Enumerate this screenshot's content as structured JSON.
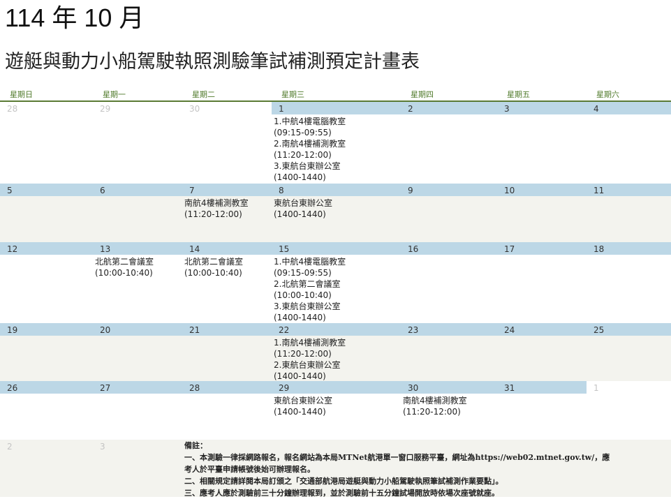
{
  "header": {
    "month_title": "114 年 10 月",
    "doc_title": "遊艇與動力小船駕駛執照測驗筆試補測預定計畫表"
  },
  "weekdays": [
    "星期日",
    "星期一",
    "星期二",
    "星期三",
    "星期四",
    "星期五",
    "星期六"
  ],
  "colors": {
    "head_blue": "#bcd7e6",
    "row_tint": "#f3f3ee",
    "accent_green": "#5a7a34"
  },
  "weeks": [
    {
      "days": [
        {
          "num": "28",
          "muted": true,
          "events": []
        },
        {
          "num": "29",
          "muted": true,
          "events": []
        },
        {
          "num": "30",
          "muted": true,
          "events": []
        },
        {
          "num": "1",
          "events": [
            "1.中航4樓電腦教室",
            "(09:15-09:55)",
            "2.南航4樓補測教室",
            "(11:20-12:00)",
            "3.東航台東辦公室",
            "(1400-1440)"
          ]
        },
        {
          "num": "2",
          "events": []
        },
        {
          "num": "3",
          "events": []
        },
        {
          "num": "4",
          "events": []
        }
      ]
    },
    {
      "days": [
        {
          "num": "5",
          "events": []
        },
        {
          "num": "6",
          "events": []
        },
        {
          "num": "7",
          "events": [
            "南航4樓補測教室",
            "(11:20-12:00)"
          ]
        },
        {
          "num": "8",
          "events": [
            "東航台東辦公室",
            "(1400-1440)"
          ]
        },
        {
          "num": "9",
          "events": []
        },
        {
          "num": "10",
          "events": []
        },
        {
          "num": "11",
          "events": []
        }
      ]
    },
    {
      "days": [
        {
          "num": "12",
          "events": []
        },
        {
          "num": "13",
          "events": [
            "北航第二會議室",
            "(10:00-10:40)"
          ]
        },
        {
          "num": "14",
          "events": [
            "北航第二會議室",
            "(10:00-10:40)"
          ]
        },
        {
          "num": "15",
          "events": [
            "1.中航4樓電腦教室",
            "(09:15-09:55)",
            "2.北航第二會議室",
            "(10:00-10:40)",
            "3.東航台東辦公室",
            "(1400-1440)"
          ]
        },
        {
          "num": "16",
          "events": []
        },
        {
          "num": "17",
          "events": []
        },
        {
          "num": "18",
          "events": []
        }
      ]
    },
    {
      "days": [
        {
          "num": "19",
          "events": []
        },
        {
          "num": "20",
          "events": []
        },
        {
          "num": "21",
          "events": []
        },
        {
          "num": "22",
          "events": [
            "1.南航4樓補測教室",
            "(11:20-12:00)",
            "2.東航台東辦公室",
            "(1400-1440)"
          ]
        },
        {
          "num": "23",
          "events": []
        },
        {
          "num": "24",
          "events": []
        },
        {
          "num": "25",
          "events": []
        }
      ]
    },
    {
      "days": [
        {
          "num": "26",
          "events": []
        },
        {
          "num": "27",
          "events": []
        },
        {
          "num": "28",
          "events": []
        },
        {
          "num": "29",
          "events": [
            "東航台東辦公室",
            "(1400-1440)"
          ]
        },
        {
          "num": "30",
          "events": [
            "南航4樓補測教室",
            "(11:20-12:00)"
          ]
        },
        {
          "num": "31",
          "events": []
        },
        {
          "num": "1",
          "muted": true,
          "events": []
        }
      ]
    },
    {
      "days": [
        {
          "num": "2",
          "muted": true,
          "events": []
        },
        {
          "num": "3",
          "muted": true,
          "events": []
        }
      ]
    }
  ],
  "notes": {
    "title": "備註：",
    "lines": [
      "一、本測驗一律採網路報名，報名網站為本局MTNet航港單一窗口服務平臺，網址為https://web02.mtnet.gov.tw/，應",
      "考人於平臺申請帳號後始可辦理報名。",
      "二、相關規定請詳閱本局訂頒之「交通部航港局遊艇與動力小船駕駛執照筆試補測作業要點」。",
      "三、應考人應於測驗前三十分鐘辦理報到，並於測驗前十五分鐘試場開放時依場次座號就座。"
    ]
  }
}
